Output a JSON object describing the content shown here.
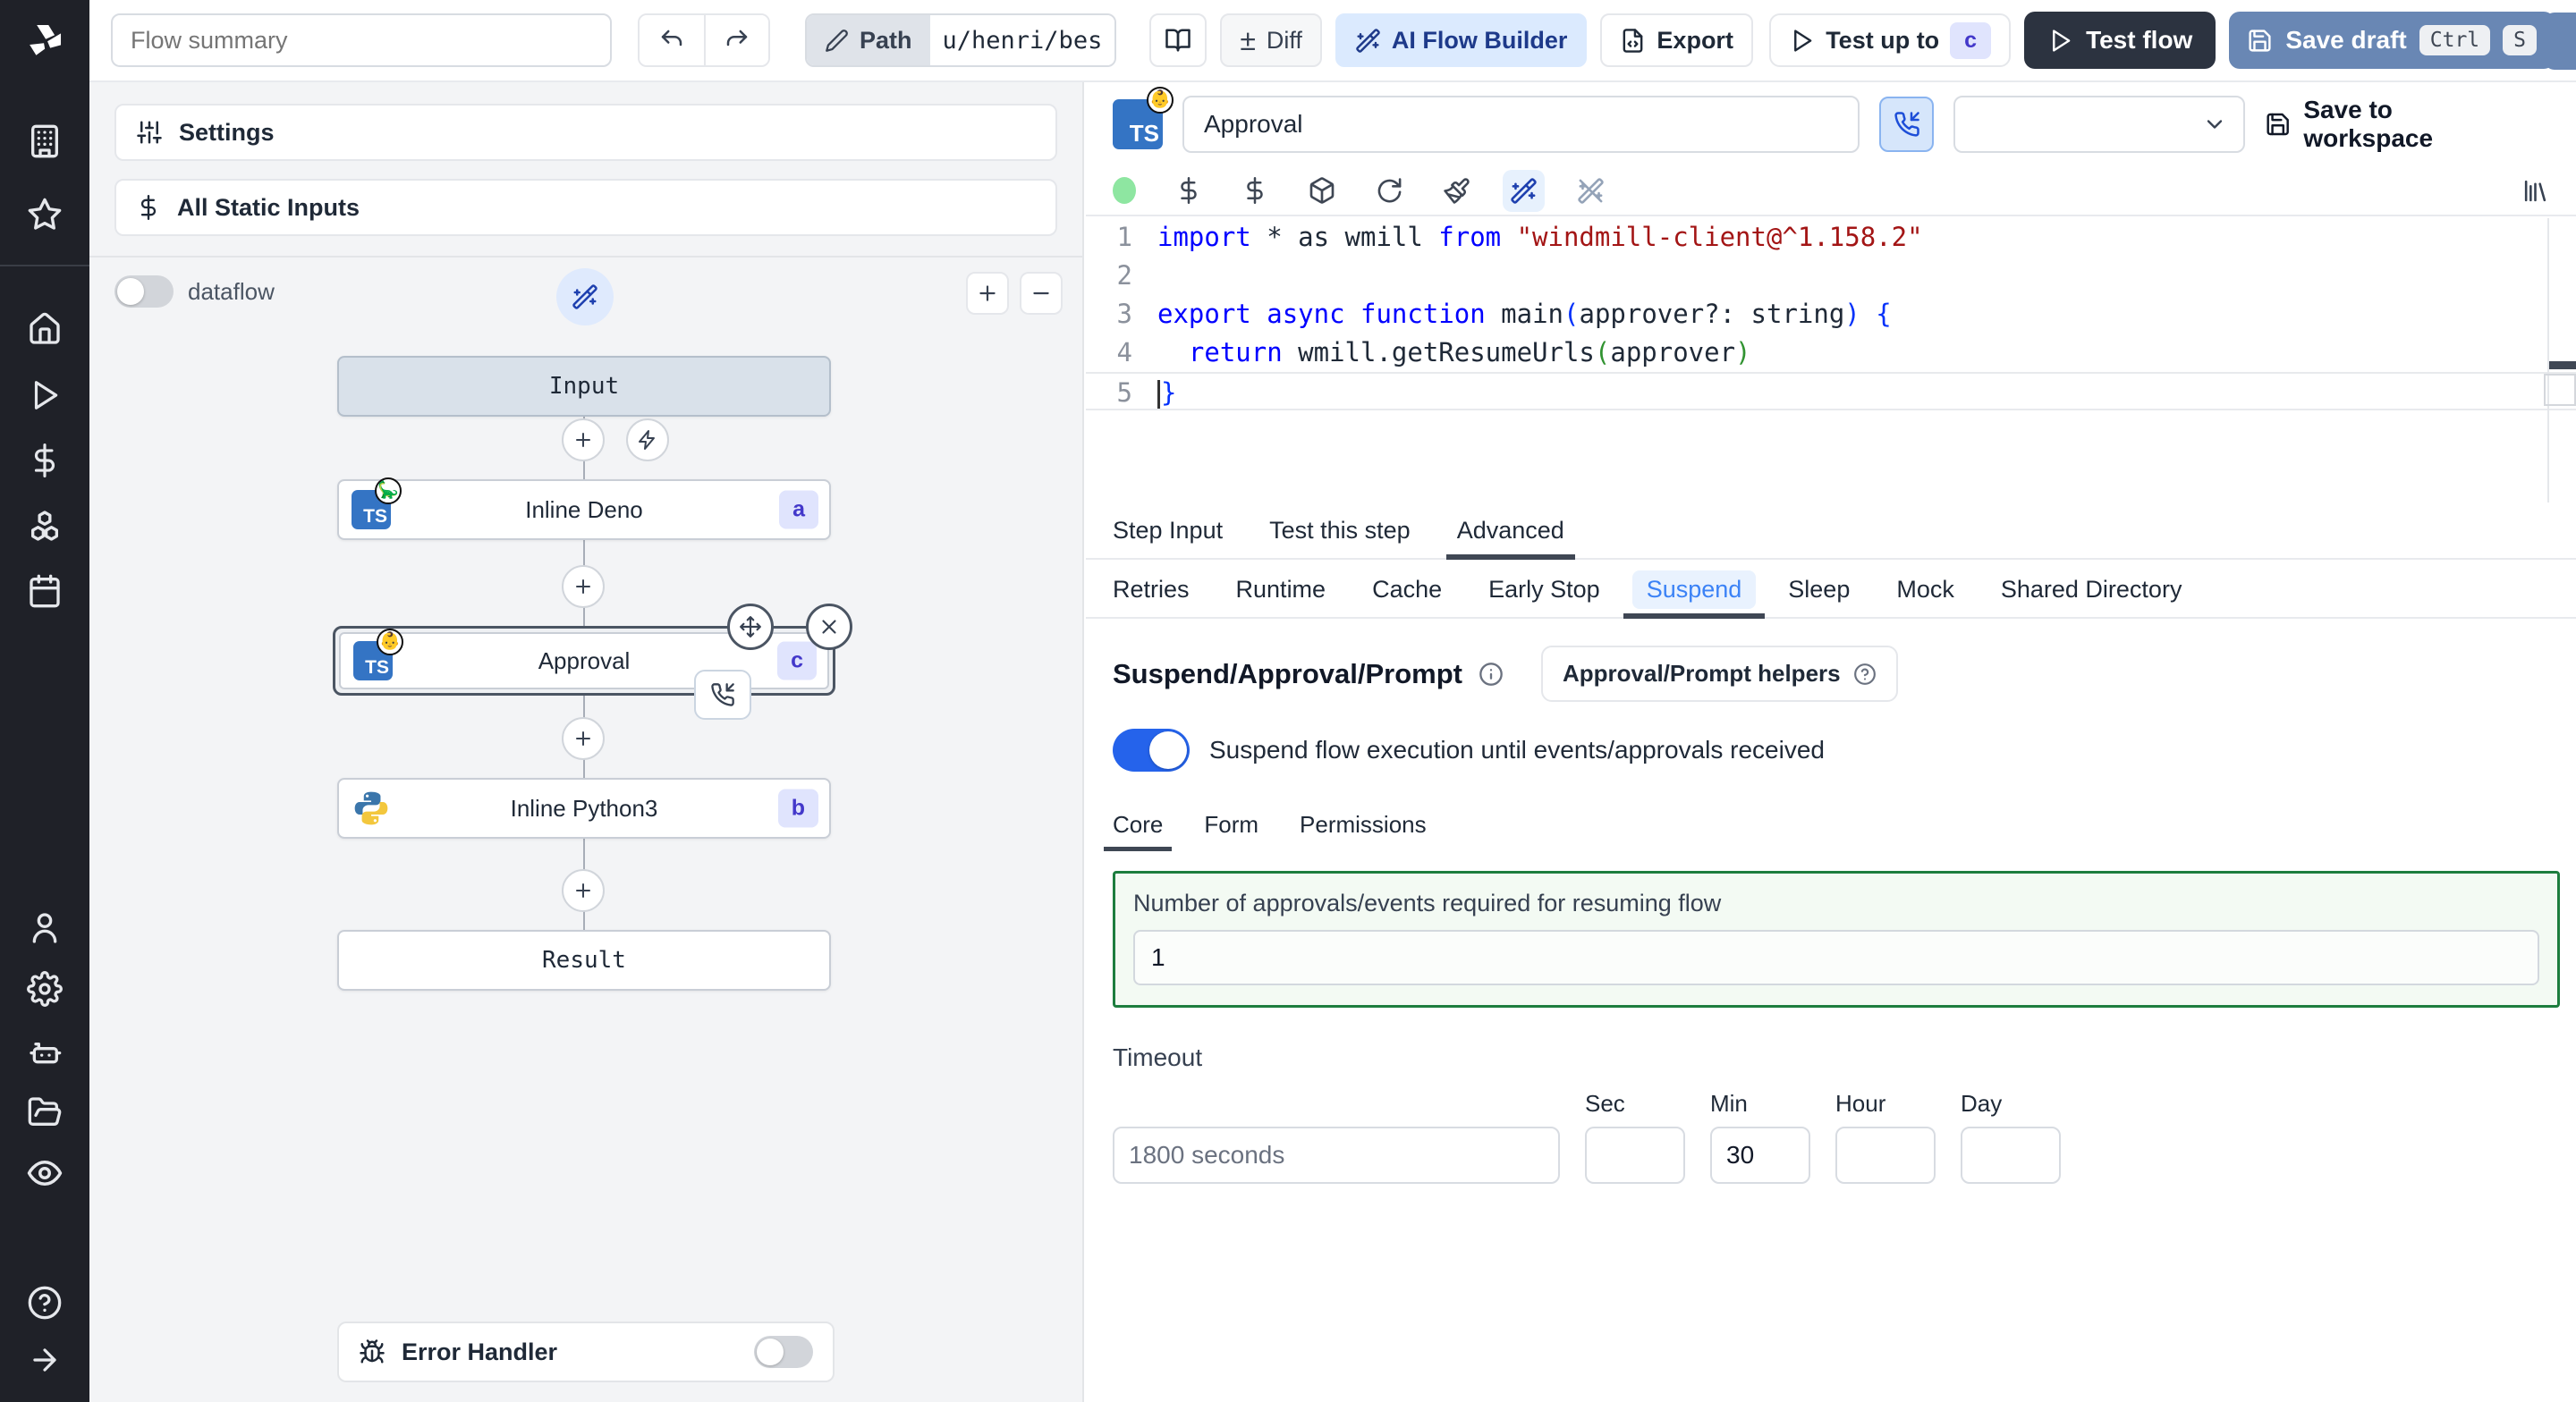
{
  "colors": {
    "accent_blue": "#2563eb",
    "ai_button_bg": "#dbeafe",
    "ai_button_text": "#1e3a8a",
    "save_draft_bg": "#6987b4",
    "test_flow_bg": "#2c3340",
    "badge_bg": "#e0e4fd",
    "badge_text": "#4338ca",
    "suspend_green_border": "#1d7d3e",
    "sidebar_bg": "#1f2128",
    "keyword": "#0000ff",
    "string": "#a31515",
    "bracket1": "#0431fa",
    "bracket2": "#319331"
  },
  "sidebar": {
    "icons": [
      "windmill-logo",
      "building",
      "star",
      "home",
      "play",
      "dollar",
      "cubes",
      "calendar",
      "user",
      "gear",
      "robot",
      "folder-open",
      "eye",
      "help-circle",
      "arrow-right"
    ]
  },
  "toolbar": {
    "flow_summary_placeholder": "Flow summary",
    "path_label": "Path",
    "path_value": "u/henri/bes",
    "diff_label": "Diff",
    "ai_flow_builder_label": "AI Flow Builder",
    "export_label": "Export",
    "test_up_to_label": "Test up to",
    "test_up_to_badge": "c",
    "test_flow_label": "Test flow",
    "save_draft_label": "Save draft",
    "kbd_ctrl": "Ctrl",
    "kbd_s": "S"
  },
  "flow_panel": {
    "settings_label": "Settings",
    "all_static_inputs_label": "All Static Inputs",
    "dataflow_label": "dataflow",
    "graph": {
      "input_label": "Input",
      "nodes": [
        {
          "label": "Inline Deno",
          "badge": "a",
          "lang": "deno",
          "emoji": "🦕"
        },
        {
          "label": "Approval",
          "badge": "c",
          "lang": "deno",
          "emoji": "👶"
        },
        {
          "label": "Inline Python3",
          "badge": "b",
          "lang": "python"
        }
      ],
      "result_label": "Result"
    },
    "error_handler_label": "Error Handler"
  },
  "editor": {
    "step_name": "Approval",
    "save_to_workspace_label": "Save to workspace",
    "code": {
      "active_line": 5,
      "line_numbers": [
        "1",
        "2",
        "3",
        "4",
        "5"
      ],
      "lines": [
        [
          {
            "t": "import",
            "c": "kw"
          },
          {
            "t": " * as wmill ",
            "c": "pl"
          },
          {
            "t": "from",
            "c": "kw"
          },
          {
            "t": " ",
            "c": "pl"
          },
          {
            "t": "\"windmill-client@^1.158.2\"",
            "c": "str"
          }
        ],
        [],
        [
          {
            "t": "export",
            "c": "kw"
          },
          {
            "t": " ",
            "c": "pl"
          },
          {
            "t": "async",
            "c": "kw"
          },
          {
            "t": " ",
            "c": "pl"
          },
          {
            "t": "function",
            "c": "kw"
          },
          {
            "t": " main",
            "c": "pl"
          },
          {
            "t": "(",
            "c": "b1"
          },
          {
            "t": "approver?: string",
            "c": "pl"
          },
          {
            "t": ")",
            "c": "b1"
          },
          {
            "t": " ",
            "c": "pl"
          },
          {
            "t": "{",
            "c": "b1"
          }
        ],
        [
          {
            "t": "  ",
            "c": "pl"
          },
          {
            "t": "return",
            "c": "kw"
          },
          {
            "t": " wmill.getResumeUrls",
            "c": "pl"
          },
          {
            "t": "(",
            "c": "b2"
          },
          {
            "t": "approver",
            "c": "pl"
          },
          {
            "t": ")",
            "c": "b2"
          }
        ],
        [
          {
            "t": "}",
            "c": "b1"
          }
        ]
      ]
    },
    "main_tabs": [
      {
        "label": "Step Input",
        "active": false
      },
      {
        "label": "Test this step",
        "active": false
      },
      {
        "label": "Advanced",
        "active": true
      }
    ],
    "sub_tabs": [
      {
        "label": "Retries"
      },
      {
        "label": "Runtime"
      },
      {
        "label": "Cache"
      },
      {
        "label": "Early Stop"
      },
      {
        "label": "Suspend",
        "active": true
      },
      {
        "label": "Sleep"
      },
      {
        "label": "Mock"
      },
      {
        "label": "Shared Directory"
      }
    ],
    "suspend_section": {
      "title": "Suspend/Approval/Prompt",
      "helpers_button_label": "Approval/Prompt helpers",
      "toggle_label": "Suspend flow execution until events/approvals received",
      "toggle_on": true,
      "tabs": [
        {
          "label": "Core",
          "active": true
        },
        {
          "label": "Form"
        },
        {
          "label": "Permissions"
        }
      ],
      "approvals_label": "Number of approvals/events required for resuming flow",
      "approvals_value": "1",
      "timeout_label": "Timeout",
      "timeout_placeholder": "1800 seconds",
      "sec_label": "Sec",
      "sec_value": "",
      "min_label": "Min",
      "min_value": "30",
      "hour_label": "Hour",
      "hour_value": "",
      "day_label": "Day",
      "day_value": ""
    }
  }
}
